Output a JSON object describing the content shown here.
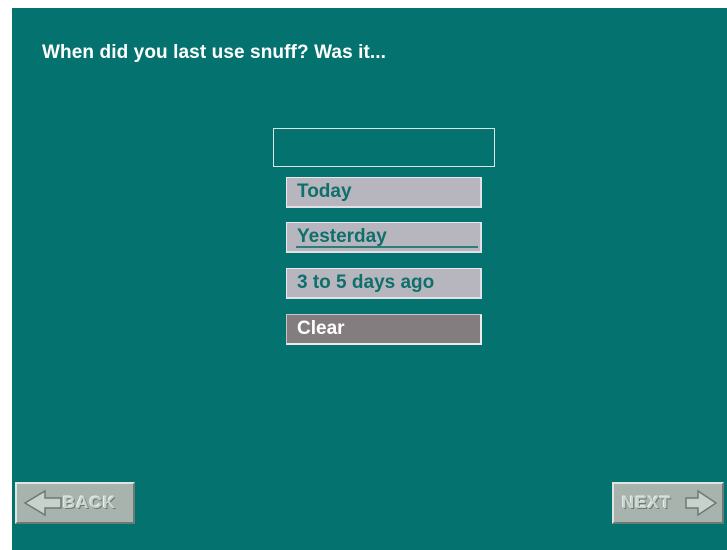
{
  "question": "When did you last use snuff? Was it...",
  "options": [
    {
      "label": "Today"
    },
    {
      "label": "Yesterday"
    },
    {
      "label": "3 to 5 days ago"
    }
  ],
  "clear_label": "Clear",
  "nav": {
    "back": "BACK",
    "next": "NEXT"
  },
  "colors": {
    "background": "#04736f",
    "option_bg": "#b7b6be",
    "option_text": "#0e6f6b",
    "clear_bg": "#837d7f"
  }
}
